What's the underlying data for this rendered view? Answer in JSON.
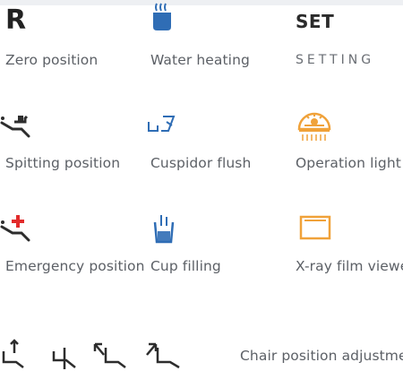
{
  "colors": {
    "icon_dark": "#2d2d2d",
    "icon_blue": "#2f6db5",
    "icon_red": "#e22b2b",
    "icon_orange": "#f0a23a",
    "label": "#5c6066"
  },
  "grid": [
    {
      "key": "zero",
      "glyph": "R",
      "label": "Zero position",
      "icon": "zero-position-icon"
    },
    {
      "key": "water",
      "label": "Water heating",
      "icon": "water-heating-icon"
    },
    {
      "key": "set",
      "glyph": "SET",
      "label": "SETTING",
      "icon": "setting-icon"
    },
    {
      "key": "spit",
      "label": "Spitting position",
      "icon": "spitting-position-icon"
    },
    {
      "key": "flush",
      "label": "Cuspidor flush",
      "icon": "cuspidor-flush-icon"
    },
    {
      "key": "light",
      "label": "Operation   light",
      "icon": "operation-light-icon"
    },
    {
      "key": "emergency",
      "label": "Emergency position",
      "icon": "emergency-position-icon"
    },
    {
      "key": "cup",
      "label": "Cup filling",
      "icon": "cup-filling-icon"
    },
    {
      "key": "xray",
      "label": "X-ray film viewer",
      "icon": "xray-film-viewer-icon"
    }
  ],
  "chair_adjust": {
    "label": "Chair position adjustment",
    "icons": [
      "backrest-up-icon",
      "seat-down-icon",
      "backrest-down-icon",
      "seat-up-icon"
    ]
  }
}
